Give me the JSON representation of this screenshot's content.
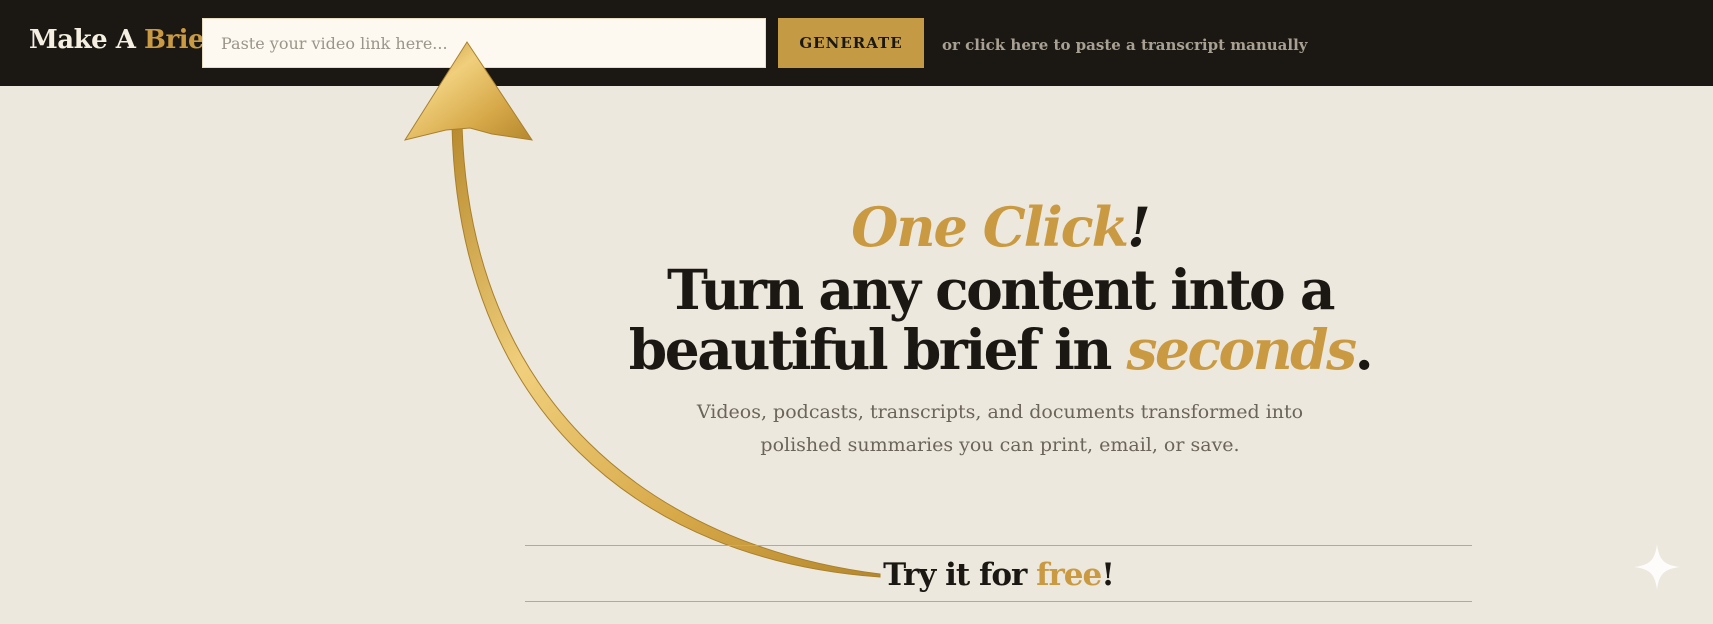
{
  "header": {
    "brand": {
      "part1": "Make A ",
      "part2": "Brief"
    },
    "video_input": {
      "placeholder": "Paste your video link here...",
      "value": ""
    },
    "generate_label": "GENERATE",
    "manual_link": "or click here to paste a transcript manually"
  },
  "hero": {
    "one_click": "One Click",
    "one_click_bang": "!",
    "headline_line1": "Turn any content into a",
    "headline_line2_prefix": "beautiful brief in ",
    "headline_accent": "seconds",
    "headline_end": ".",
    "subtitle_line1": "Videos, podcasts, transcripts, and documents transformed into",
    "subtitle_line2": "polished summaries you can print, email, or save."
  },
  "cta": {
    "prefix": "Try it for ",
    "accent": "free",
    "suffix": "!"
  },
  "icons": {
    "arrow": "curved-arrow-icon",
    "sparkle": "sparkle-icon"
  },
  "colors": {
    "background": "#ede8de",
    "header_bg": "#1b1813",
    "accent_gold": "#c99a42",
    "text_dark": "#1b1813",
    "text_muted": "#6b6459"
  }
}
